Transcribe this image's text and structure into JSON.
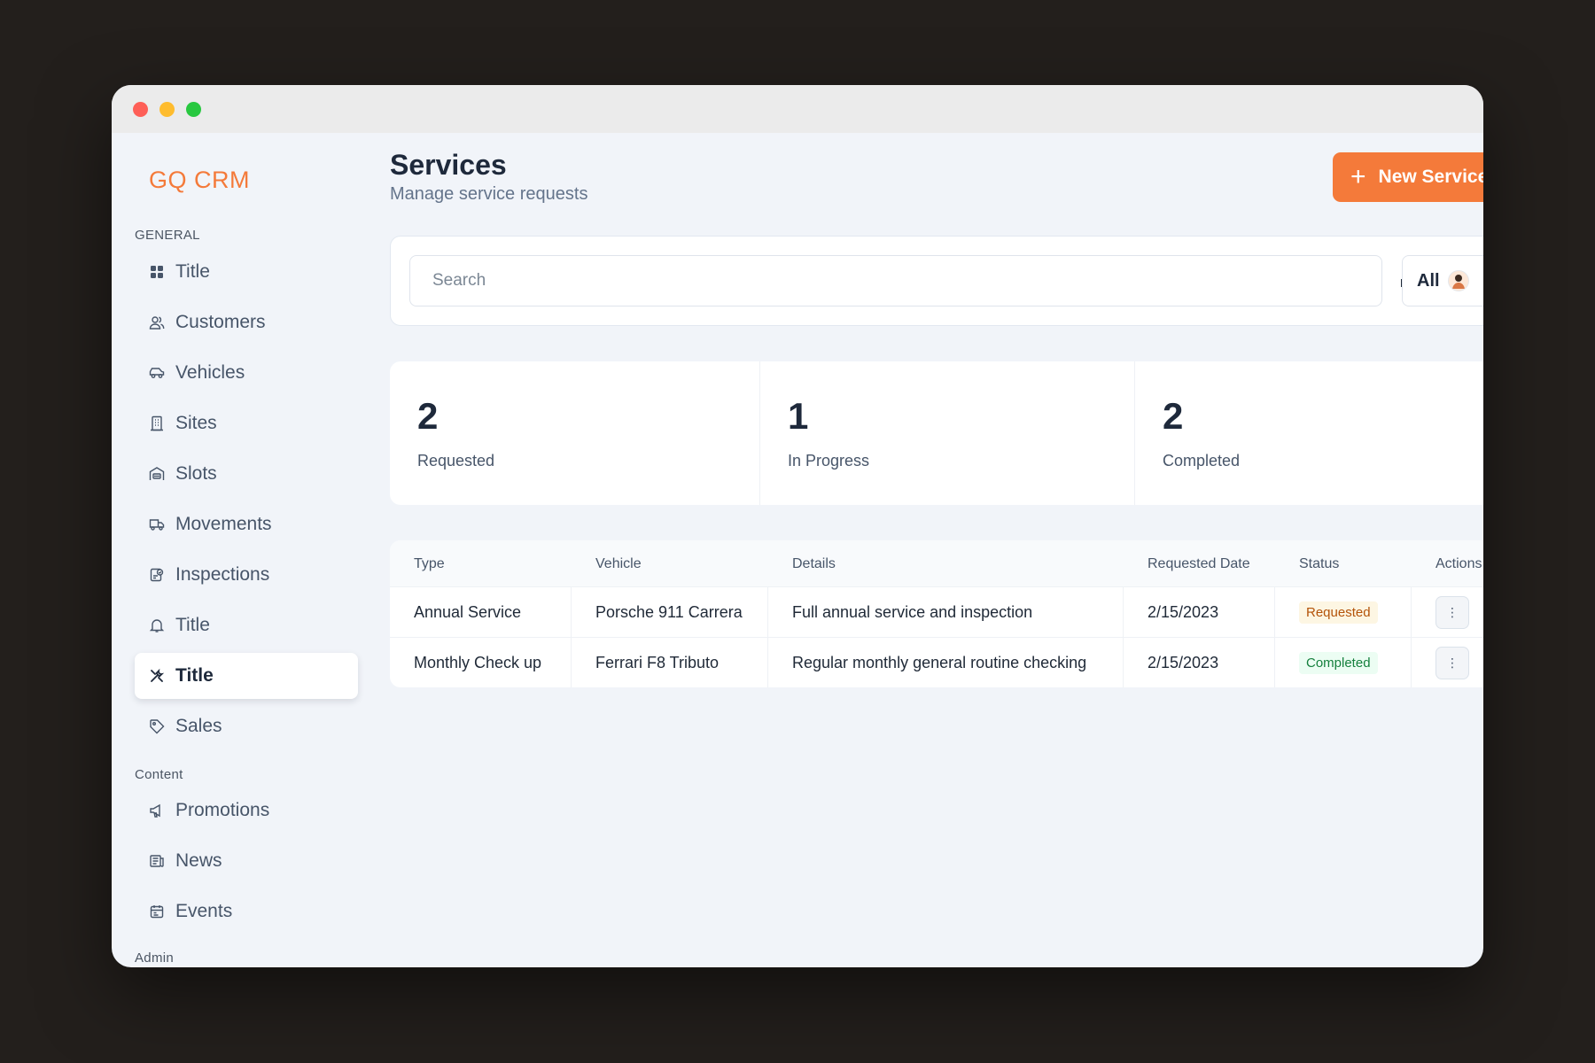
{
  "brand": {
    "name": "GQ CRM",
    "color": "#f47a3a"
  },
  "sidebar": {
    "sections": [
      {
        "label": "GENERAL"
      },
      {
        "label": "Content"
      },
      {
        "label": "Admin"
      }
    ],
    "items": [
      {
        "label": "Title",
        "icon": "grid-icon"
      },
      {
        "label": "Customers",
        "icon": "users-icon"
      },
      {
        "label": "Vehicles",
        "icon": "car-icon"
      },
      {
        "label": "Sites",
        "icon": "building-icon"
      },
      {
        "label": "Slots",
        "icon": "garage-icon"
      },
      {
        "label": "Movements",
        "icon": "truck-icon"
      },
      {
        "label": "Inspections",
        "icon": "clipboard-check-icon"
      },
      {
        "label": "Title",
        "icon": "bell-icon"
      },
      {
        "label": "Title",
        "icon": "tools-icon",
        "active": true
      },
      {
        "label": "Sales",
        "icon": "tag-icon"
      },
      {
        "label": "Promotions",
        "icon": "megaphone-icon"
      },
      {
        "label": "News",
        "icon": "newspaper-icon"
      },
      {
        "label": "Events",
        "icon": "calendar-icon"
      }
    ]
  },
  "header": {
    "title": "Services",
    "subtitle": "Manage service requests",
    "new_button_label": "New Service"
  },
  "search": {
    "placeholder": "Search",
    "value": ""
  },
  "filter": {
    "label": "All"
  },
  "stats": [
    {
      "value": "2",
      "label": "Requested"
    },
    {
      "value": "1",
      "label": "In Progress"
    },
    {
      "value": "2",
      "label": "Completed"
    }
  ],
  "table": {
    "columns": [
      "Type",
      "Vehicle",
      "Details",
      "Requested Date",
      "Status",
      "Actions"
    ],
    "rows": [
      {
        "type": "Annual Service",
        "vehicle": "Porsche 911 Carrera",
        "details": "Full annual service and inspection",
        "date": "2/15/2023",
        "status": "Requested"
      },
      {
        "type": "Monthly Check up",
        "vehicle": "Ferrari F8 Tributo",
        "details": "Regular monthly general routine checking",
        "date": "2/15/2023",
        "status": "Completed"
      }
    ],
    "action_glyph": "⋮"
  },
  "status_colors": {
    "requested": "#b45309",
    "completed": "#15803d"
  }
}
